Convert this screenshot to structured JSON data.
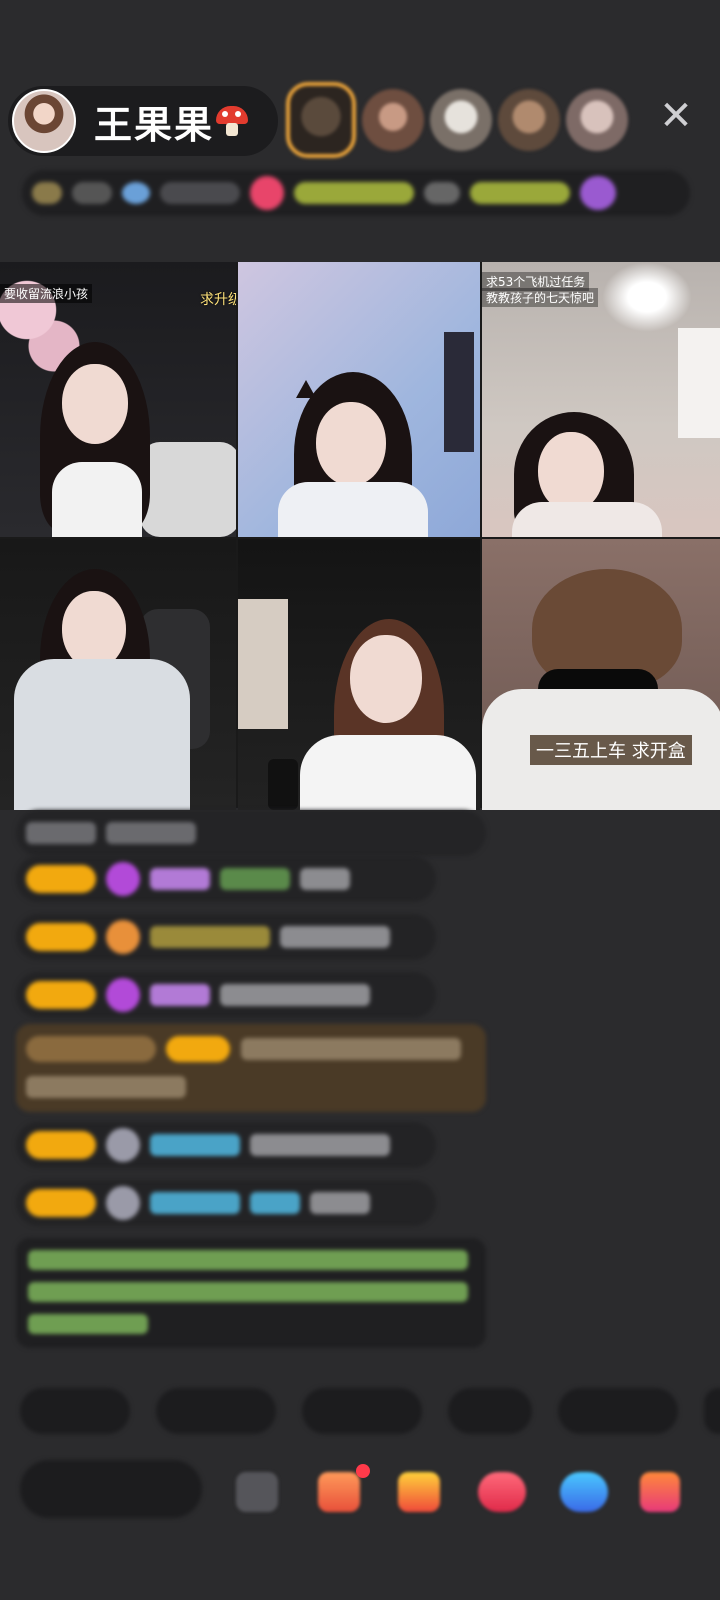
{
  "host": {
    "name": "王果果",
    "avatar_icon": "host-avatar",
    "badge_icon": "mushroom-icon"
  },
  "viewers": [
    {
      "icon": "viewer-avatar-top",
      "color": "#6b5a4a"
    },
    {
      "icon": "viewer-avatar",
      "color": "#8c6a5a"
    },
    {
      "icon": "viewer-avatar",
      "color": "#bdb5ad"
    },
    {
      "icon": "viewer-avatar",
      "color": "#9a7a64"
    },
    {
      "icon": "viewer-avatar",
      "color": "#a08a86"
    }
  ],
  "close_icon": "close-icon",
  "video_tiles": [
    {
      "caption_top_left": "要收留流浪小孩",
      "caption_top_right": "求升级"
    },
    {},
    {
      "caption_line1": "求53个飞机过任务",
      "caption_line2": "教教孩子的七天惊吧"
    },
    {},
    {},
    {
      "caption_overlay": "一三五上车 求开盒"
    }
  ],
  "colors": {
    "badge_gold": "#f2a90f",
    "chat_bg": "#232325",
    "page_bg": "#2b2b2d",
    "system_green": "#7fbf5f",
    "name_purple": "#b27ad6",
    "name_blue": "#4aa3c7"
  }
}
